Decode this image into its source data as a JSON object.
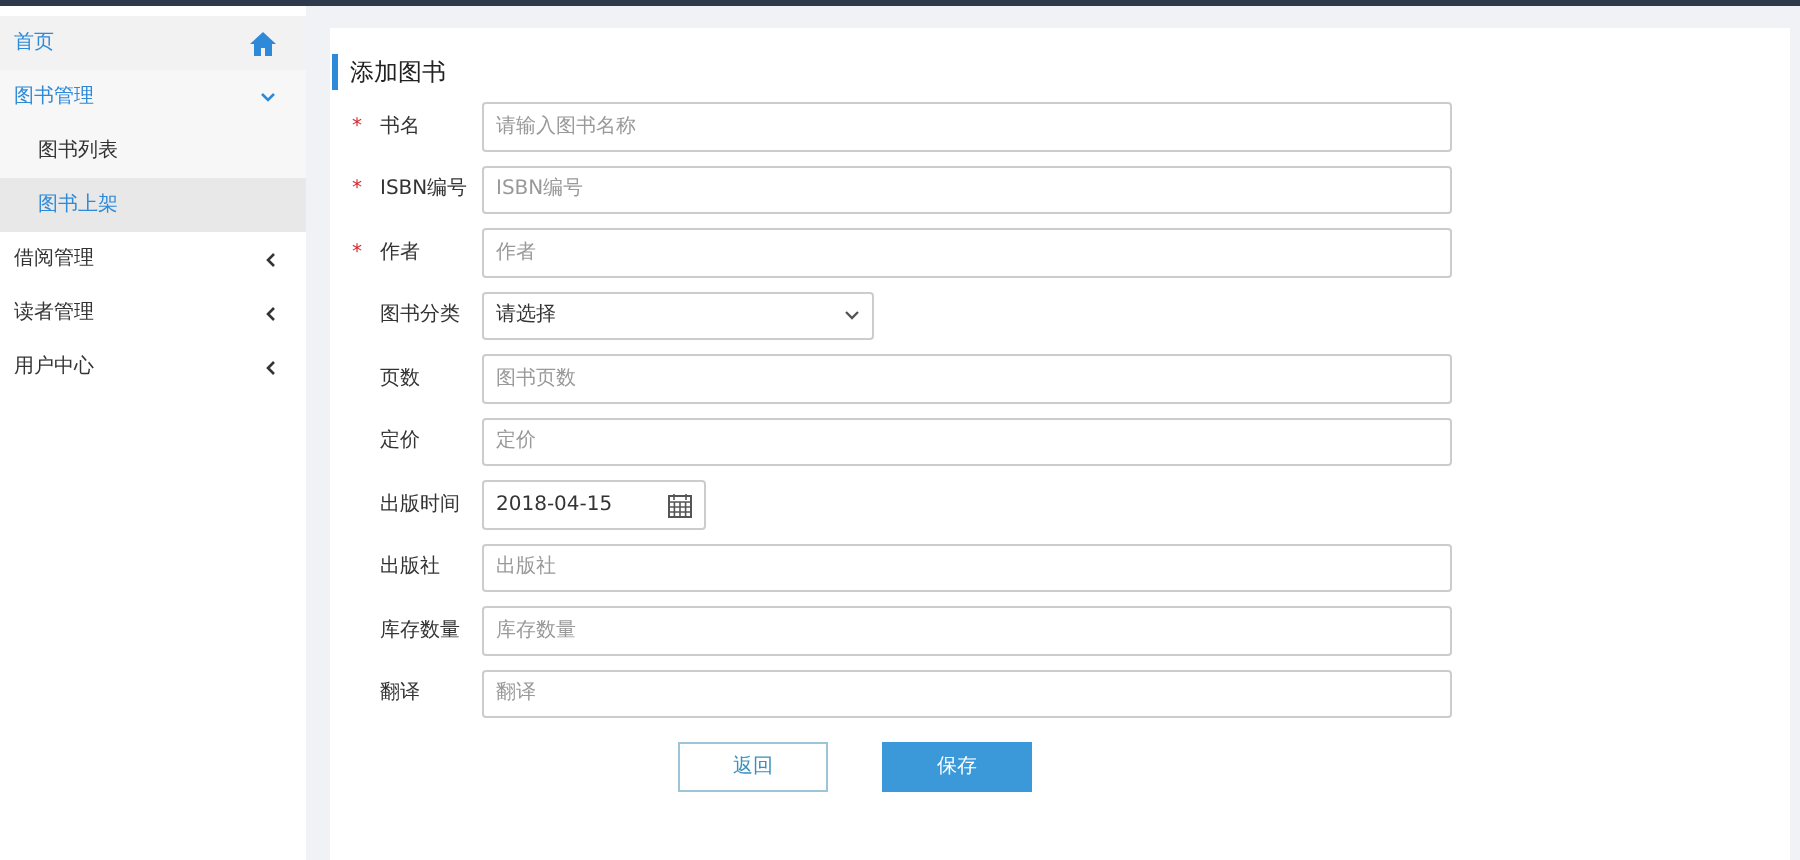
{
  "sidebar": {
    "items": [
      {
        "label": "首页",
        "kind": "home"
      },
      {
        "label": "图书管理",
        "kind": "group",
        "expanded": true,
        "selected": false,
        "children": [
          {
            "label": "图书列表",
            "selected": false
          },
          {
            "label": "图书上架",
            "selected": true
          }
        ]
      },
      {
        "label": "借阅管理",
        "kind": "group",
        "expanded": false,
        "selected": false
      },
      {
        "label": "读者管理",
        "kind": "group",
        "expanded": false,
        "selected": false
      },
      {
        "label": "用户中心",
        "kind": "group",
        "expanded": false,
        "selected": false
      }
    ]
  },
  "form": {
    "title": "添加图书",
    "fields": [
      {
        "label": "书名",
        "marker": "*",
        "kind": "text",
        "placeholder": "请输入图书名称"
      },
      {
        "label": "ISBN编号",
        "marker": "*",
        "kind": "text",
        "placeholder": "ISBN编号"
      },
      {
        "label": "作者",
        "marker": "*",
        "kind": "text",
        "placeholder": "作者"
      },
      {
        "label": "图书分类",
        "kind": "select",
        "value": "请选择"
      },
      {
        "label": "页数",
        "kind": "text",
        "placeholder": "图书页数"
      },
      {
        "label": "定价",
        "kind": "text",
        "placeholder": "定价"
      },
      {
        "label": "出版时间",
        "kind": "date",
        "value": "2018-04-15"
      },
      {
        "label": "出版社",
        "kind": "text",
        "placeholder": "出版社"
      },
      {
        "label": "库存数量",
        "kind": "text",
        "placeholder": "库存数量"
      },
      {
        "label": "翻译",
        "kind": "text",
        "placeholder": "翻译"
      }
    ],
    "buttons": [
      {
        "label": "返回",
        "kind": "secondary"
      },
      {
        "label": "保存",
        "kind": "primary"
      }
    ]
  }
}
